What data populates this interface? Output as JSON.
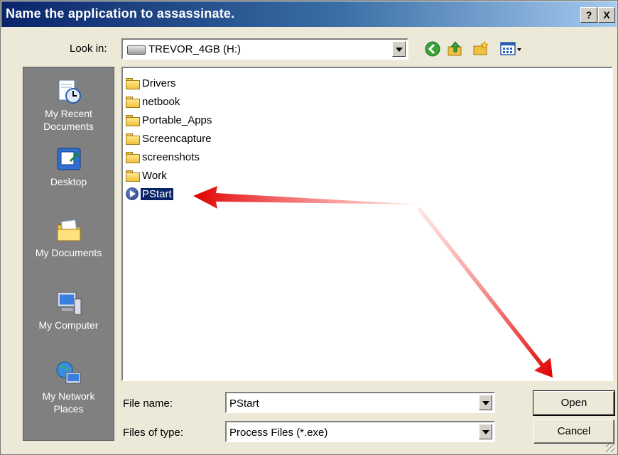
{
  "window": {
    "title": "Name the application to assassinate.",
    "help_label": "?",
    "close_label": "X"
  },
  "lookin": {
    "label": "Look in:",
    "value": "TREVOR_4GB (H:)"
  },
  "toolbar": {
    "icons": [
      "back-icon",
      "up-folder-icon",
      "new-folder-icon",
      "views-menu-icon"
    ]
  },
  "places": [
    {
      "label_lines": [
        "My Recent",
        "Documents"
      ],
      "icon": "my-recent-documents-icon"
    },
    {
      "label_lines": [
        "Desktop"
      ],
      "icon": "desktop-icon"
    },
    {
      "label_lines": [
        "My Documents"
      ],
      "icon": "my-documents-icon"
    },
    {
      "label_lines": [
        "My Computer"
      ],
      "icon": "my-computer-icon"
    },
    {
      "label_lines": [
        "My Network",
        "Places"
      ],
      "icon": "my-network-places-icon"
    }
  ],
  "files": [
    {
      "name": "Drivers",
      "type": "folder"
    },
    {
      "name": "netbook",
      "type": "folder"
    },
    {
      "name": "Portable_Apps",
      "type": "folder"
    },
    {
      "name": "Screencapture",
      "type": "folder"
    },
    {
      "name": "screenshots",
      "type": "folder"
    },
    {
      "name": "Work",
      "type": "folder"
    },
    {
      "name": "PStart",
      "type": "exe",
      "selected": true
    }
  ],
  "filename": {
    "label": "File name:",
    "value": "PStart"
  },
  "filetype": {
    "label": "Files of type:",
    "value": "Process Files (*.exe)"
  },
  "buttons": {
    "open": "Open",
    "cancel": "Cancel"
  },
  "colors": {
    "title_bar": "#0a246a",
    "places_bg": "#808080",
    "selection": "#0a246a",
    "arrow": "#e00000"
  }
}
